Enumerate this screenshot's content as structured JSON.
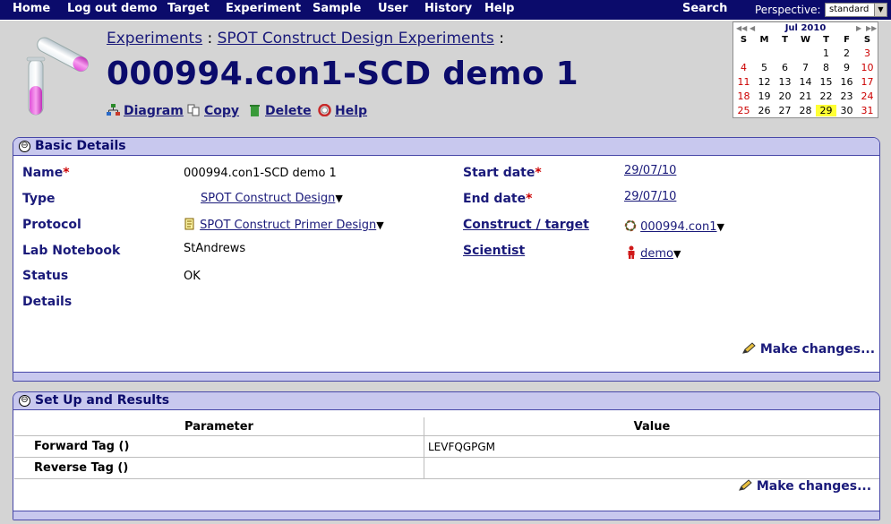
{
  "nav": {
    "items": [
      "Home",
      "Log out demo",
      "Target",
      "Experiment",
      "Sample",
      "User",
      "History",
      "Help"
    ],
    "search": "Search",
    "perspective_label": "Perspective:",
    "perspective_value": "standard"
  },
  "breadcrumb": {
    "experiments": "Experiments",
    "sep1": ":",
    "category": "SPOT Construct Design Experiments",
    "sep2": ":"
  },
  "page_title": "000994.con1-SCD demo 1",
  "actions": {
    "diagram": "Diagram",
    "copy": "Copy",
    "delete": "Delete",
    "help": "Help"
  },
  "calendar": {
    "title": "Jul 2010",
    "dow": [
      "S",
      "M",
      "T",
      "W",
      "T",
      "F",
      "S"
    ],
    "weeks": [
      [
        "",
        "",
        "",
        "",
        "1",
        "2",
        "3"
      ],
      [
        "4",
        "5",
        "6",
        "7",
        "8",
        "9",
        "10"
      ],
      [
        "11",
        "12",
        "13",
        "14",
        "15",
        "16",
        "17"
      ],
      [
        "18",
        "19",
        "20",
        "21",
        "22",
        "23",
        "24"
      ],
      [
        "25",
        "26",
        "27",
        "28",
        "29",
        "30",
        "31"
      ]
    ],
    "today": "29",
    "highlight_color": "#ffff33"
  },
  "basic": {
    "title": "Basic Details",
    "toggle": "⊖",
    "required_mark": "*",
    "name_label": "Name",
    "name_value": "000994.con1-SCD demo 1",
    "type_label": "Type",
    "type_value": "SPOT Construct Design",
    "protocol_label": "Protocol",
    "protocol_value": "SPOT Construct Primer Design",
    "notebook_label": "Lab Notebook",
    "notebook_value": "StAndrews",
    "status_label": "Status",
    "status_value": "OK",
    "details_label": "Details",
    "start_label": "Start date",
    "start_value": "29/07/10",
    "end_label": "End date",
    "end_value": "29/07/10",
    "construct_label": "Construct / target",
    "construct_value": "000994.con1",
    "scientist_label": "Scientist",
    "scientist_value": "demo",
    "make_changes": "Make changes..."
  },
  "results": {
    "title": "Set Up and Results",
    "toggle": "⊖",
    "col_parameter": "Parameter",
    "col_value": "Value",
    "rows": [
      {
        "parameter": "Forward Tag ()",
        "value": "LEVFQGPGM"
      },
      {
        "parameter": "Reverse Tag ()",
        "value": ""
      }
    ],
    "make_changes": "Make changes..."
  },
  "colors": {
    "nav_bg": "#0b0b6b",
    "panel_header": "#c8c8ee",
    "required": "#cc0000"
  }
}
